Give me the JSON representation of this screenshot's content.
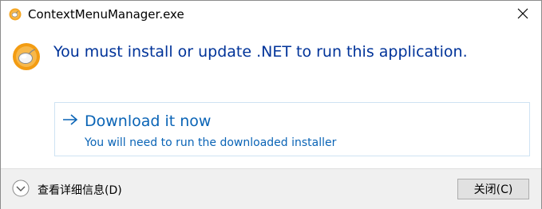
{
  "window": {
    "title": "ContextMenuManager.exe",
    "close_glyph": "✕"
  },
  "message": {
    "headline": "You must install or update .NET to run this application."
  },
  "command_link": {
    "arrow": "→",
    "title": "Download it now",
    "subtitle": "You will need to run the downloaded installer"
  },
  "footer": {
    "details_label": "查看详细信息(D)",
    "close_button_label": "关闭(C)"
  },
  "colors": {
    "headline": "#003399",
    "link": "#0a64b6",
    "footer_bg": "#f0f0f0",
    "app_icon_orange": "#f5a623"
  },
  "icons": {
    "app": "mouse-app-icon",
    "expand": "chevron-down-circle-icon",
    "close": "close-icon",
    "arrow": "arrow-right-icon"
  }
}
